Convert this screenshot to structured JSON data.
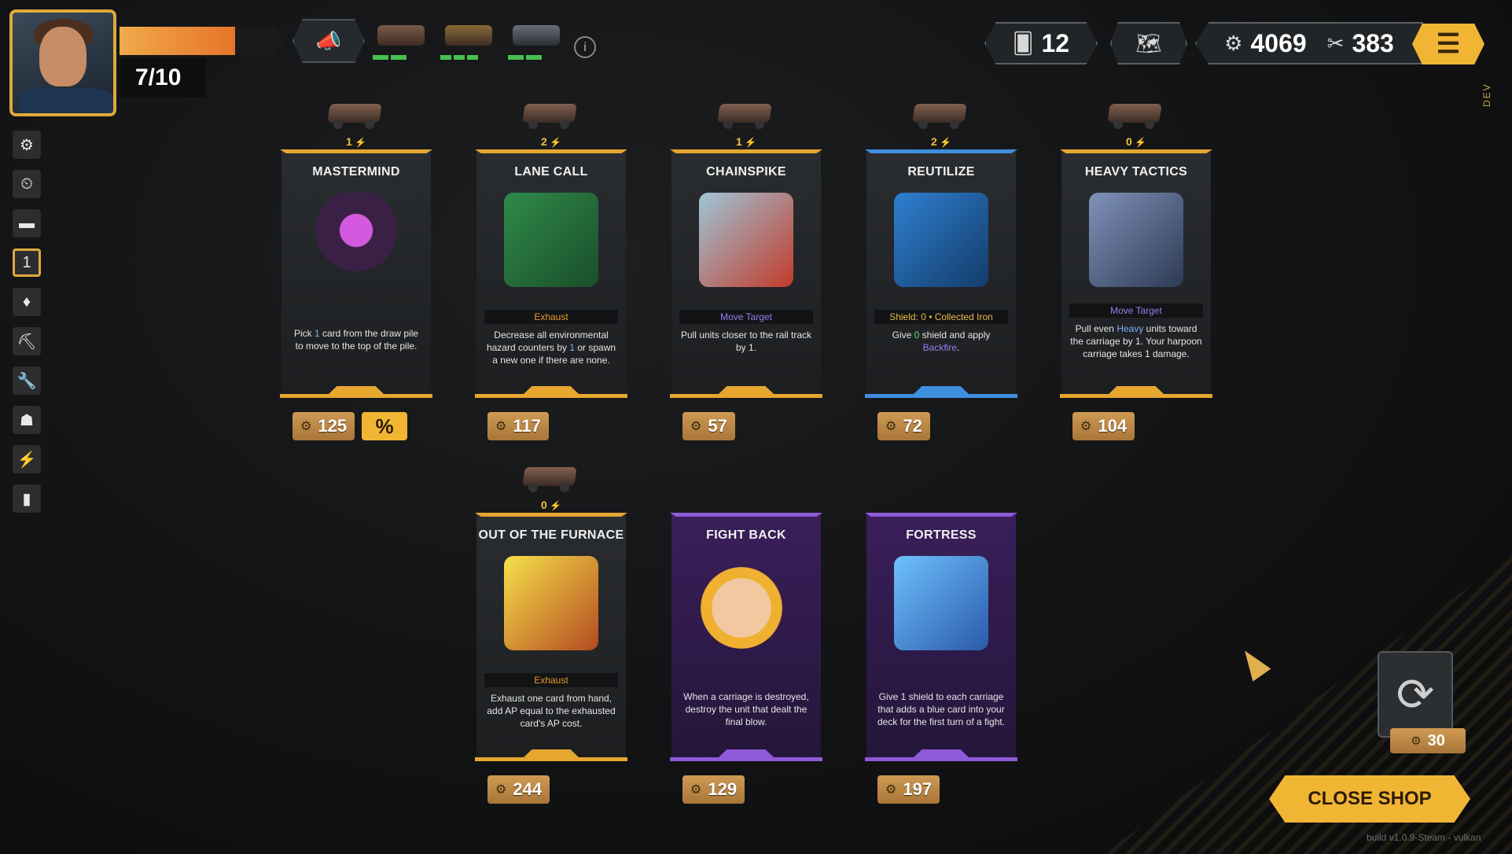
{
  "hud": {
    "health_text": "7/10",
    "health_fraction": 0.7,
    "deck_count": "12",
    "scrap": "4069",
    "nails": "383",
    "dev_label": "DEV",
    "info_icon": "info-icon",
    "carriages": [
      "cannon-carriage",
      "crane-carriage",
      "plow-carriage"
    ]
  },
  "relics": [
    "gear-relic",
    "clock-relic",
    "cannon-relic",
    "number-one-relic",
    "lantern-relic",
    "pickaxe-relic",
    "wrench-relic",
    "mask-relic",
    "lightning-relic",
    "cloak-relic"
  ],
  "cards": [
    {
      "name": "MASTERMIND",
      "cost": "1",
      "rarity": "gold",
      "tag": "",
      "desc_parts": [
        "Pick ",
        "1",
        " card from the draw pile to move to the top of the pile."
      ],
      "price": "125",
      "sale": "%"
    },
    {
      "name": "LANE CALL",
      "cost": "2",
      "rarity": "gold",
      "tag": "Exhaust",
      "desc_parts": [
        "Decrease all environmental hazard counters by ",
        "1",
        " or spawn a new one if there are none."
      ],
      "price": "117"
    },
    {
      "name": "CHAINSPIKE",
      "cost": "1",
      "rarity": "gold",
      "tag": "Move Target",
      "desc_parts": [
        "Pull units closer to the rail track by 1."
      ],
      "price": "57"
    },
    {
      "name": "REUTILIZE",
      "cost": "2",
      "rarity": "blue",
      "tag": "Shield: 0 • Collected Iron",
      "desc_parts": [
        "Give ",
        "0",
        " shield and apply ",
        "Backfire",
        "."
      ],
      "price": "72"
    },
    {
      "name": "HEAVY TACTICS",
      "cost": "0",
      "rarity": "gold",
      "tag": "Move Target",
      "desc_parts": [
        "Pull even ",
        "Heavy",
        " units toward the carriage by 1. Your harpoon carriage takes 1 damage."
      ],
      "price": "104"
    },
    {
      "name": "OUT OF THE FURNACE",
      "cost": "0",
      "rarity": "gold",
      "tag": "Exhaust",
      "desc_parts": [
        "Exhaust one card from hand, add AP equal to the exhausted card's AP cost."
      ],
      "price": "244"
    },
    {
      "name": "FIGHT BACK",
      "cost": "",
      "rarity": "purple",
      "tag": "",
      "desc_parts": [
        "When a carriage is destroyed, destroy the unit that dealt the final blow."
      ],
      "price": "129"
    },
    {
      "name": "FORTRESS",
      "cost": "",
      "rarity": "purple",
      "tag": "",
      "desc_parts": [
        "Give 1 shield to each carriage that adds a blue card into your deck for the first turn of a fight."
      ],
      "price": "197"
    }
  ],
  "reroll": {
    "price": "30"
  },
  "close_label": "CLOSE SHOP",
  "build": "build v1.0.9-Steam - vulkan"
}
